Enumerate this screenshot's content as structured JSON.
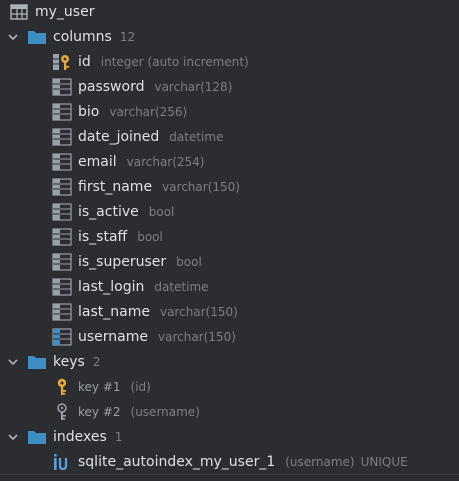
{
  "table": {
    "name": "my_user"
  },
  "columns_group": {
    "label": "columns",
    "count": "12"
  },
  "columns": [
    {
      "name": "id",
      "type": "integer (auto increment)",
      "icon": "primary-key-column-icon"
    },
    {
      "name": "password",
      "type": "varchar(128)",
      "icon": "column-icon"
    },
    {
      "name": "bio",
      "type": "varchar(256)",
      "icon": "column-icon"
    },
    {
      "name": "date_joined",
      "type": "datetime",
      "icon": "column-icon"
    },
    {
      "name": "email",
      "type": "varchar(254)",
      "icon": "column-icon"
    },
    {
      "name": "first_name",
      "type": "varchar(150)",
      "icon": "column-icon"
    },
    {
      "name": "is_active",
      "type": "bool",
      "icon": "column-icon"
    },
    {
      "name": "is_staff",
      "type": "bool",
      "icon": "column-icon"
    },
    {
      "name": "is_superuser",
      "type": "bool",
      "icon": "column-icon"
    },
    {
      "name": "last_login",
      "type": "datetime",
      "icon": "column-icon"
    },
    {
      "name": "last_name",
      "type": "varchar(150)",
      "icon": "column-icon"
    },
    {
      "name": "username",
      "type": "varchar(150)",
      "icon": "indexed-column-icon"
    }
  ],
  "keys_group": {
    "label": "keys",
    "count": "2"
  },
  "keys": [
    {
      "name": "key #1",
      "cols": "(id)",
      "icon": "primary-key-icon"
    },
    {
      "name": "key #2",
      "cols": "(username)",
      "icon": "unique-key-icon"
    }
  ],
  "indexes_group": {
    "label": "indexes",
    "count": "1"
  },
  "indexes": [
    {
      "name": "sqlite_autoindex_my_user_1",
      "cols": "(username)",
      "kind": "UNIQUE",
      "icon": "unique-index-icon"
    }
  ],
  "colors": {
    "background": "#2b2d30",
    "text": "#dfe1e5",
    "muted": "#7c7f86",
    "folder": "#3d8fc6",
    "key_gold": "#e3a93b",
    "column_icon": "#9aa1ab"
  }
}
